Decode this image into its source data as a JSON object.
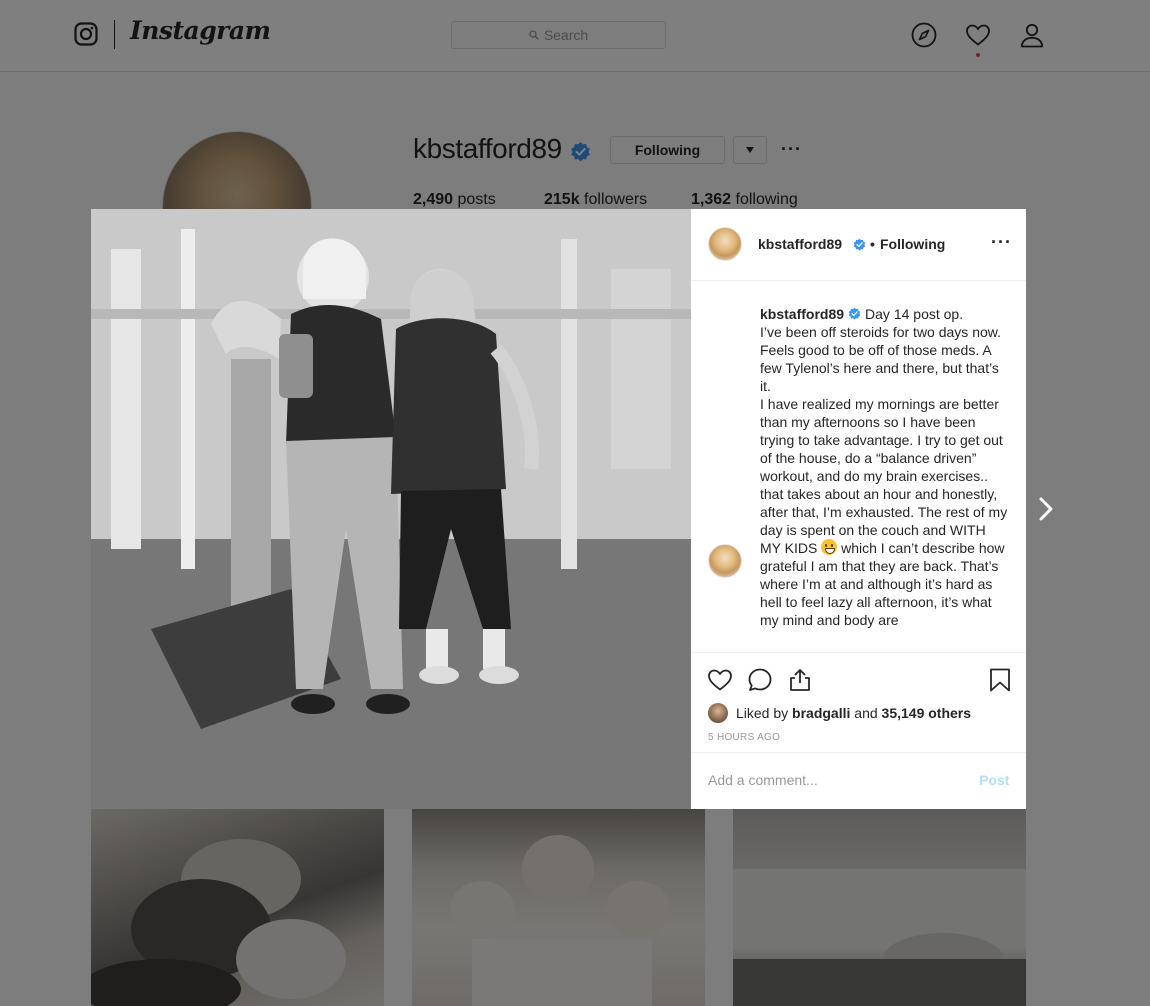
{
  "topnav": {
    "wordmark": "Instagram",
    "search_placeholder": "Search",
    "icons": [
      "instagram-glyph-icon",
      "search-icon",
      "compass-icon",
      "heart-icon",
      "person-icon"
    ]
  },
  "profile": {
    "username": "kbstafford89",
    "following_button": "Following",
    "more": "···",
    "stats": [
      {
        "value": "2,490",
        "label": "posts"
      },
      {
        "value": "215k",
        "label": "followers"
      },
      {
        "value": "1,362",
        "label": "following"
      }
    ]
  },
  "post": {
    "header": {
      "username": "kbstafford89",
      "separator": "•",
      "following": "Following",
      "more": "···"
    },
    "caption": {
      "username": "kbstafford89",
      "lines": [
        "Day 14 post op.",
        "I’ve been off steroids for two days now. Feels good to be off of those meds. A few Tylenol’s here and there, but that’s it.",
        "I have realized my mornings are better than my afternoons so I have been trying to take advantage. I try to get out of the house, do a “balance driven” workout, and do my brain exercises.. that takes about an hour and honestly, after that, I’m exhausted. The rest of my day is spent on the couch and WITH MY KIDS",
        "which I can’t describe how grateful I am that they are back. That’s where I’m at and although it’s hard as hell to feel lazy all afternoon, it’s what my mind and body are"
      ]
    },
    "likes": {
      "prefix": "Liked by",
      "user": "bradgalli",
      "joiner": "and",
      "others": "35,149 others"
    },
    "timestamp": "5 HOURS AGO",
    "comment_placeholder": "Add a comment...",
    "post_button": "Post"
  },
  "colors": {
    "verified": "#3897f0",
    "link_disabled": "#b2dffc",
    "notification": "#ed4956",
    "border": "#dbdbdb"
  }
}
